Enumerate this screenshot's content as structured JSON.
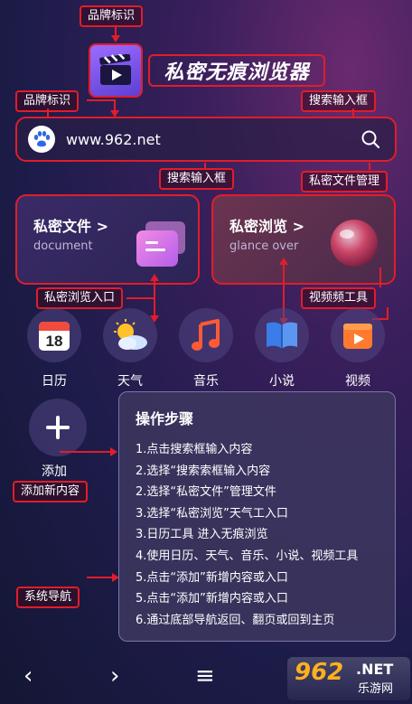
{
  "annotations": {
    "brand_top": "品牌标识",
    "brand_left": "品牌标识",
    "search_right": "搜索输入框",
    "search_bottom": "搜索输入框",
    "private_file_manage": "私密文件管理",
    "private_browse_entry": "私密浏览入口",
    "video_tool": "视频频工具",
    "add_new": "添加新内容",
    "system_nav": "系统导航"
  },
  "header": {
    "app_title": "私密无痕浏览器"
  },
  "search": {
    "value": "www.962.net",
    "icon": "search-icon",
    "engine_icon": "baidu-paw-icon"
  },
  "cards": {
    "file": {
      "title": "私密文件 >",
      "subtitle": "document",
      "icon": "folder-icon"
    },
    "browse": {
      "title": "私密浏览 >",
      "subtitle": "glance over",
      "icon": "glass-orb-icon"
    }
  },
  "apps": [
    {
      "label": "日历",
      "icon": "calendar-icon",
      "day": "18"
    },
    {
      "label": "天气",
      "icon": "weather-icon"
    },
    {
      "label": "音乐",
      "icon": "music-icon"
    },
    {
      "label": "小说",
      "icon": "book-icon"
    },
    {
      "label": "视频",
      "icon": "video-icon"
    }
  ],
  "add": {
    "label": "添加",
    "icon": "plus-icon"
  },
  "steps_panel": {
    "title": "操作步骤",
    "steps": [
      "1.点击搜索框输入内容",
      "2.选择“搜索索框输入内容",
      "2.选择“私密文件”管理文件",
      "3.选择“私密浏览”天气工入口",
      "3.日历工具  进入无痕浏览",
      "4.使用日历、天气、音乐、小说、视频工具",
      "5.点击“添加”新增内容或入口",
      "5.点击“添加”新增内容或入口",
      "6.通过底部导航返回、翻页或回到主页"
    ]
  },
  "nav": {
    "back": "‹",
    "forward": "›",
    "menu": "≡"
  },
  "watermark": {
    "main": "962",
    "net": ".NET",
    "sub": "乐游网"
  },
  "colors": {
    "annotation": "#e11d2a",
    "accent_pink": "#e85aa8",
    "music": "#ff5a36"
  }
}
